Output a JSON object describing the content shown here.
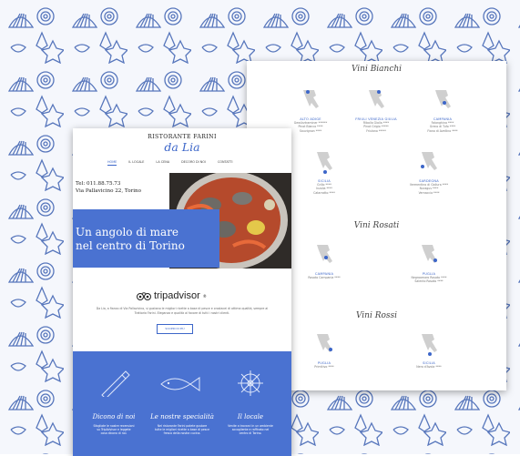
{
  "background": {
    "pattern": "blue-seashell-pattern",
    "pattern_color": "#3a5fb0",
    "paper_color": "#f4f6fb"
  },
  "wine_page": {
    "sections": {
      "bianchi": "Vini Bianchi",
      "rosati": "Vini Rosati",
      "rossi": "Vini Rossi"
    },
    "bianchi_wines": [
      {
        "region": "ALTO ADIGE",
        "names": "Gewürztraminer ******\nPinot Bianco ****\nSauvignon ****"
      },
      {
        "region": "FRIULI VENEZIA GIULIA",
        "names": "Ribolla Gialla ****\nPinot Grigio *****\nFriulano *****"
      },
      {
        "region": "CAMPANIA",
        "names": "Falanghina ****\nGreco di Tufo ****\nFiano di Avellino ****"
      },
      {
        "region": "SICILIA",
        "names": "Grillo ****\nInzolia ****\nCatarratto ****"
      },
      {
        "region": "SARDEGNA",
        "names": "Vermentino di Gallura ****\nNuragus ****\nVernaccia ****"
      }
    ],
    "rosati_wines": [
      {
        "region": "CAMPANIA",
        "names": "Rosato Campania ****"
      },
      {
        "region": "PUGLIA",
        "names": "Negroamaro Rosato ****\nSalento Rosato ****"
      }
    ],
    "rossi_wines": [
      {
        "region": "PUGLIA",
        "names": "Primitivo ****"
      },
      {
        "region": "SICILIA",
        "names": "Nero d'Avola ****"
      }
    ]
  },
  "resto_page": {
    "brand_top": "RISTORANTE FARINI",
    "brand_script": "da Lia",
    "nav": [
      "HOME",
      "IL LOCALE",
      "LA CENA",
      "DECORO DI NOI",
      "CONTATTI"
    ],
    "phone": "Tel: 011.88.75.73",
    "address": "Via Pallavicino 22, Torino",
    "tagline_1": "Un angolo di mare",
    "tagline_2": "nel centro di Torino",
    "tripadvisor": "tripadvisor",
    "tripadvisor_suffix": "®",
    "review": "Da Lia, a fianco di Via Pallavicino, si gustano le migliori ricette a base di pesce e crostacei\ndi ottima qualità, sempre ai Trattoria Farini. Eleganza e qualità al favore di tutti i nostri clienti.",
    "button_label": "SCOPRI DI PIÙ",
    "footer": [
      {
        "icon": "telescope-icon",
        "heading": "Dicono di noi",
        "text": "Sfogliate le nostre recensioni\nsu TripAdvisor e leggete\ncosa dicono di noi."
      },
      {
        "icon": "fish-icon",
        "heading": "Le nostre specialità",
        "text": "Nel ristorante Farini potete gustare\ntutte le migliori ricette a base di pesce\nfresco della nostra cucina."
      },
      {
        "icon": "ship-wheel-icon",
        "heading": "Il locale",
        "text": "Venite a trovarci in un ambiente\naccogliente e raffinato nel\ncentro di Torino."
      }
    ],
    "accent": "#4a72d1"
  }
}
